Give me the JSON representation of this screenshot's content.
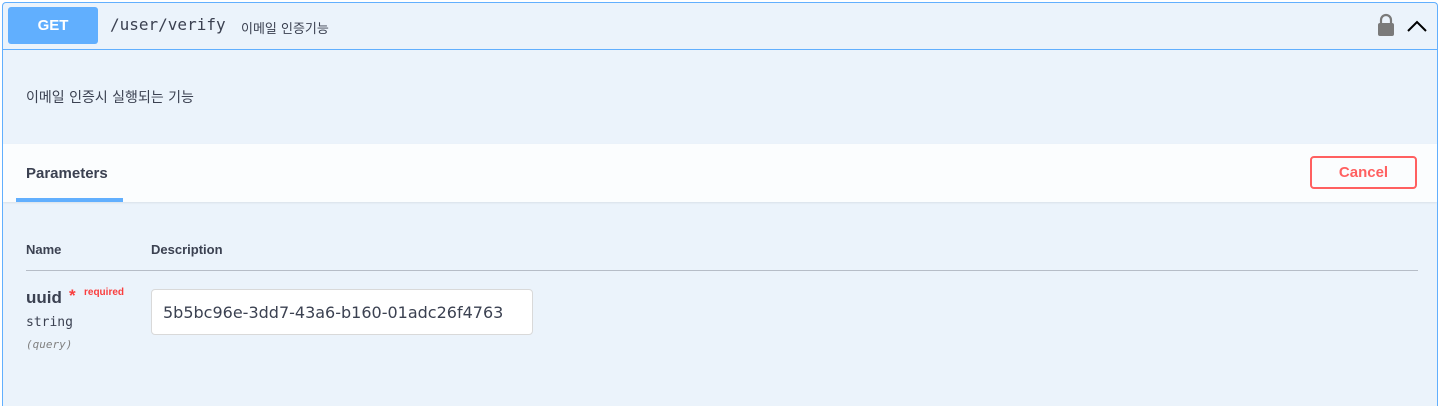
{
  "operation": {
    "method": "GET",
    "path": "/user/verify",
    "summary": "이메일 인증기능",
    "description": "이메일 인증시 실행되는 기능",
    "locked": true,
    "expanded": true
  },
  "parameters_section": {
    "tab_label": "Parameters",
    "cancel_label": "Cancel"
  },
  "table": {
    "headers": {
      "name": "Name",
      "description": "Description"
    },
    "rows": [
      {
        "name": "uuid",
        "required_mark": "*",
        "required_label": "required",
        "type": "string",
        "location": "(query)",
        "value": "5b5bc96e-3dd7-43a6-b160-01adc26f4763"
      }
    ]
  },
  "colors": {
    "method_get": "#61affe",
    "background": "#ebf3fb",
    "cancel": "#ff6060",
    "required": "#f93e3e",
    "text": "#3b4151"
  },
  "icons": {
    "lock": "lock-icon",
    "collapse": "chevron-up-icon"
  }
}
